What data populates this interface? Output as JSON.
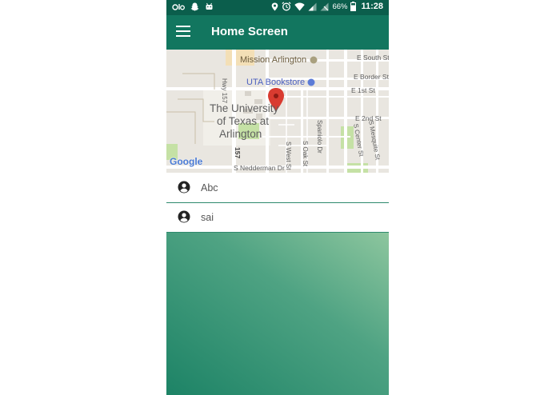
{
  "status_bar": {
    "battery_percent": "66%",
    "time": "11:28",
    "left_icons": [
      "ola-icon",
      "snapchat-icon",
      "android-icon"
    ],
    "right_icons": [
      "location-icon",
      "alarm-icon",
      "wifi-icon",
      "signal-icon",
      "no-signal-icon",
      "battery-icon"
    ]
  },
  "app_bar": {
    "title": "Home Screen",
    "color": "#12765f"
  },
  "map": {
    "labels": {
      "mission_arlington": "Mission Arlington",
      "uta_bookstore": "UTA Bookstore",
      "university_line1": "The University",
      "university_line2": "of Texas at",
      "university_line3": "Arlington",
      "e_south_st": "E South St",
      "e_border_st": "E Border St",
      "e_1st_st": "E 1st St",
      "e_2nd_st": "E 2nd St",
      "hwy_157": "Hwy 157",
      "hwy_157_short": "157",
      "spaniolo_dr": "Spaniolo Dr",
      "s_oak_st": "S Oak St",
      "s_west_st": "S West St",
      "s_center_st": "S Center St",
      "s_mesquite_st": "S Mesquite St",
      "s_nedderman_dr": "S Nedderman Dr",
      "google": "Google"
    }
  },
  "list": {
    "items": [
      {
        "label": "Abc"
      },
      {
        "label": "sai"
      }
    ]
  },
  "colors": {
    "status_bar": "#0b5e4c",
    "gradient_top": "#8dc69e",
    "gradient_bottom": "#1d8366",
    "marker": "#d93b30"
  }
}
